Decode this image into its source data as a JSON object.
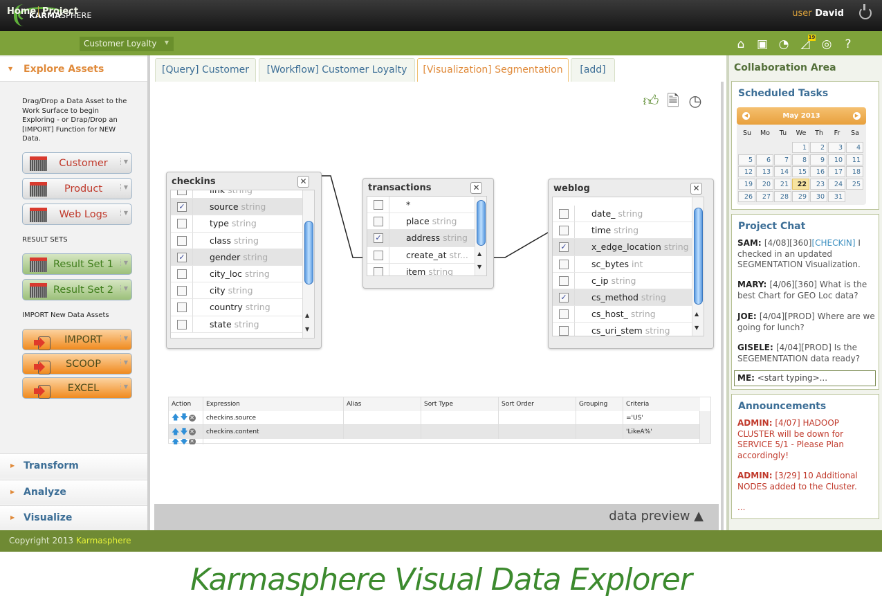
{
  "topbar": {
    "logo_bold": "KARMA",
    "logo_light": "SPHERE",
    "user_label": "user",
    "user_name": "David",
    "power_icon": "power-icon"
  },
  "navbar": {
    "home": "Home",
    "project": "Project",
    "project_select": "Customer Loyalty",
    "icons": [
      "home-icon",
      "data-search-icon",
      "clock-arrow-icon",
      "notification-icon",
      "chat-search-icon",
      "help-icon"
    ],
    "notification_count": "19"
  },
  "left": {
    "explore_title": "Explore Assets",
    "help_text": "Drag/Drop a Data Asset to the Work Surface to begin Exploring - or Drap/Drop an [IMPORT] Function for NEW Data.",
    "assets": [
      "Customer",
      "Product",
      "Web Logs"
    ],
    "result_sets_label": "RESULT SETS",
    "result_sets": [
      "Result Set 1",
      "Result Set 2"
    ],
    "import_label": "IMPORT New Data Assets",
    "imports": [
      "IMPORT",
      "SCOOP",
      "EXCEL"
    ],
    "accordions": [
      "Transform",
      "Analyze",
      "Visualize"
    ]
  },
  "tabs": [
    {
      "label": "[Query] Customer",
      "active": false
    },
    {
      "label": "[Workflow] Customer Loyalty",
      "active": false
    },
    {
      "label": "[Visualization] Segmentation",
      "active": true
    },
    {
      "label": "[add]",
      "active": false
    }
  ],
  "work_icons": [
    "thumbs-up-icon",
    "document-search-icon",
    "clock-icon"
  ],
  "tables": {
    "checkins": {
      "title": "checkins",
      "fields": [
        {
          "name": "link",
          "type": "string",
          "checked": false
        },
        {
          "name": "source",
          "type": "string",
          "checked": true
        },
        {
          "name": "type",
          "type": "string",
          "checked": false
        },
        {
          "name": "class",
          "type": "string",
          "checked": false
        },
        {
          "name": "gender",
          "type": "string",
          "checked": true
        },
        {
          "name": "city_loc",
          "type": "string",
          "checked": false
        },
        {
          "name": "city",
          "type": "string",
          "checked": false
        },
        {
          "name": "country",
          "type": "string",
          "checked": false
        },
        {
          "name": "state",
          "type": "string",
          "checked": false
        }
      ]
    },
    "transactions": {
      "title": "transactions",
      "fields": [
        {
          "name": "*",
          "type": "",
          "checked": false
        },
        {
          "name": "place",
          "type": "string",
          "checked": false
        },
        {
          "name": "address",
          "type": "string",
          "checked": true
        },
        {
          "name": "create_at",
          "type": "str...",
          "checked": false
        },
        {
          "name": "item",
          "type": "string",
          "checked": false
        }
      ]
    },
    "weblog": {
      "title": "weblog",
      "fields": [
        {
          "name": "date_",
          "type": "string",
          "checked": false
        },
        {
          "name": "time",
          "type": "string",
          "checked": false
        },
        {
          "name": "x_edge_location",
          "type": "string",
          "checked": true
        },
        {
          "name": "sc_bytes",
          "type": "int",
          "checked": false
        },
        {
          "name": "c_ip",
          "type": "string",
          "checked": false
        },
        {
          "name": "cs_method",
          "type": "string",
          "checked": true
        },
        {
          "name": "cs_host_",
          "type": "string",
          "checked": false
        },
        {
          "name": "cs_uri_stem",
          "type": "string",
          "checked": false
        }
      ]
    }
  },
  "grid": {
    "headers": [
      "Action",
      "Expression",
      "Alias",
      "Sort Type",
      "Sort Order",
      "Grouping",
      "Criteria"
    ],
    "rows": [
      {
        "expression": "checkins.source",
        "alias": "",
        "sort_type": "",
        "sort_order": "",
        "grouping": "",
        "criteria": "='US'"
      },
      {
        "expression": "checkins.content",
        "alias": "",
        "sort_type": "",
        "sort_order": "",
        "grouping": "",
        "criteria": "'LikeA%'"
      }
    ]
  },
  "data_preview": "data preview ▲",
  "right": {
    "title": "Collaboration Area",
    "scheduled_title": "Scheduled Tasks",
    "calendar": {
      "month": "May 2013",
      "weekdays": [
        "Su",
        "Mo",
        "Tu",
        "We",
        "Th",
        "Fr",
        "Sa"
      ],
      "first_weekday": 3,
      "days": 31,
      "today": 22
    },
    "chat_title": "Project Chat",
    "chat": [
      {
        "who": "SAM:",
        "pre": "[4/08][360]",
        "tag": "[CHECKIN]",
        "msg": " I checked in an updated SEGMENTATION Visualization."
      },
      {
        "who": "MARY:",
        "pre": "[4/06][360]",
        "tag": "",
        "msg": " What is the best Chart for GEO Loc data?"
      },
      {
        "who": "JOE:",
        "pre": "[4/04][PROD]",
        "tag": "",
        "msg": " Where are we going for lunch?"
      },
      {
        "who": "GISELE:",
        "pre": "[4/04][PROD]",
        "tag": "",
        "msg": " Is the SEGEMENTATION data ready?"
      }
    ],
    "chat_input_who": "ME:",
    "chat_input_placeholder": "<start typing>...",
    "announcements_title": "Announcements",
    "announcements": [
      {
        "who": "ADMIN:",
        "msg": " [4/07] HADOOP CLUSTER will be down for SERVICE 5/1 - Please Plan accordingly!"
      },
      {
        "who": "ADMIN:",
        "msg": " [3/29] 10 Additional NODES added to the Cluster."
      }
    ],
    "announcements_more": "..."
  },
  "footer": {
    "copyright": "Copyright 2013",
    "brand": "Karmasphere"
  },
  "caption": "Karmasphere Visual Data Explorer"
}
